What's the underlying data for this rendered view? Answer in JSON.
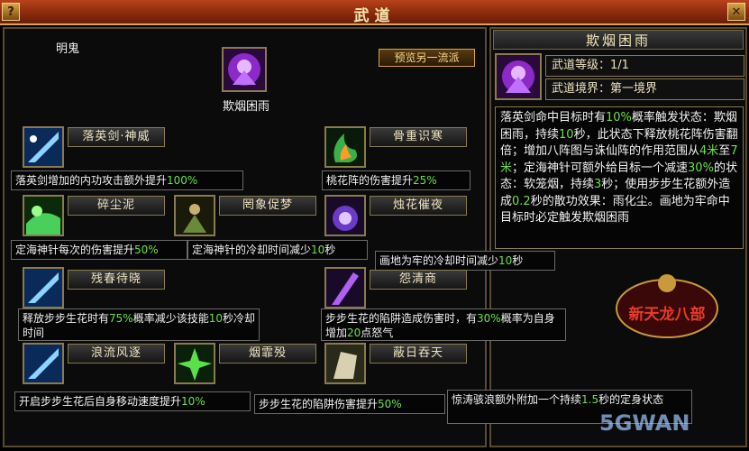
{
  "window": {
    "title": "武道",
    "help_label": "?",
    "close_label": "✕"
  },
  "left": {
    "player_name": "明鬼",
    "center_skill_name": "欺烟困雨",
    "preview_button": "预览另一流派",
    "skills": [
      {
        "name": "落英剑·神威",
        "icon": "sword-light-icon"
      },
      {
        "name": "骨重识寒",
        "icon": "green-flame-icon"
      },
      {
        "name": "碎尘泥",
        "icon": "green-mist-icon"
      },
      {
        "name": "罔象促梦",
        "icon": "dark-figure-icon"
      },
      {
        "name": "烛花催夜",
        "icon": "purple-orb-icon"
      },
      {
        "name": "残春待晓",
        "icon": "sword-light-icon"
      },
      {
        "name": "怨清商",
        "icon": "purple-blade-icon"
      },
      {
        "name": "浪流风逐",
        "icon": "sword-light-icon"
      },
      {
        "name": "烟霏殁",
        "icon": "green-burst-icon"
      },
      {
        "name": "蔽日吞天",
        "icon": "stone-fist-icon"
      }
    ],
    "descs": {
      "d1": {
        "text": "落英剑增加的内功攻击额外提升",
        "pct": "100%"
      },
      "d2": {
        "text": "桃花阵的伤害提升",
        "pct": "25%"
      },
      "d3": {
        "text": "定海神针每次的伤害提升",
        "pct": "50%"
      },
      "d4a": "定海神针的冷却时间减少",
      "d4n": "10",
      "d4b": "秒",
      "d5a": "画地为牢的冷却时间减少",
      "d5n": "10",
      "d5b": "秒",
      "d6a": "释放步步生花时有",
      "d6p": "75%",
      "d6b": "概率减少该技能",
      "d6n": "10",
      "d6c": "秒冷却时间",
      "d7a": "步步生花的陷阱造成伤害时，有",
      "d7p": "30%",
      "d7b": "概率为自身增加",
      "d7n": "20",
      "d7c": "点怒气",
      "d8": {
        "text": "开启步步生花后自身移动速度提升",
        "pct": "10%"
      },
      "d9": {
        "text": "步步生花的陷阱伤害提升",
        "pct": "50%"
      },
      "d10a": "惊涛骇浪额外附加一个持续",
      "d10n": "1.5",
      "d10b": "秒的定身状态"
    }
  },
  "right": {
    "header": "欺烟困雨",
    "level": "武道等级：1/1",
    "realm": "武道境界：第一境界",
    "description": [
      {
        "t": "落英剑命中目标时有",
        "g": "10%",
        "t2": "概率触发状态：欺烟困雨，持续",
        "g2": "10",
        "t3": "秒，此状态下释放桃花阵伤害翻倍；增加八阵图与诛仙阵的作用范围从",
        "g3": "4米",
        "t4": "至",
        "g4": "7米",
        "t5": "；定海神针可额外给目标一个减速",
        "g5": "30%",
        "t6": "的状态：软笼烟，持续",
        "g6": "3",
        "t7": "秒；使用步步生花额外造成",
        "g7": "0.2",
        "t8": "秒的散功效果：雨化尘。画地为牢命中目标时必定触发欺烟困雨"
      }
    ],
    "logo_text": "新天龙八部",
    "watermark": "5GWAN"
  },
  "colors": {
    "accent": "#d9a548",
    "highlight": "#6be04a"
  }
}
